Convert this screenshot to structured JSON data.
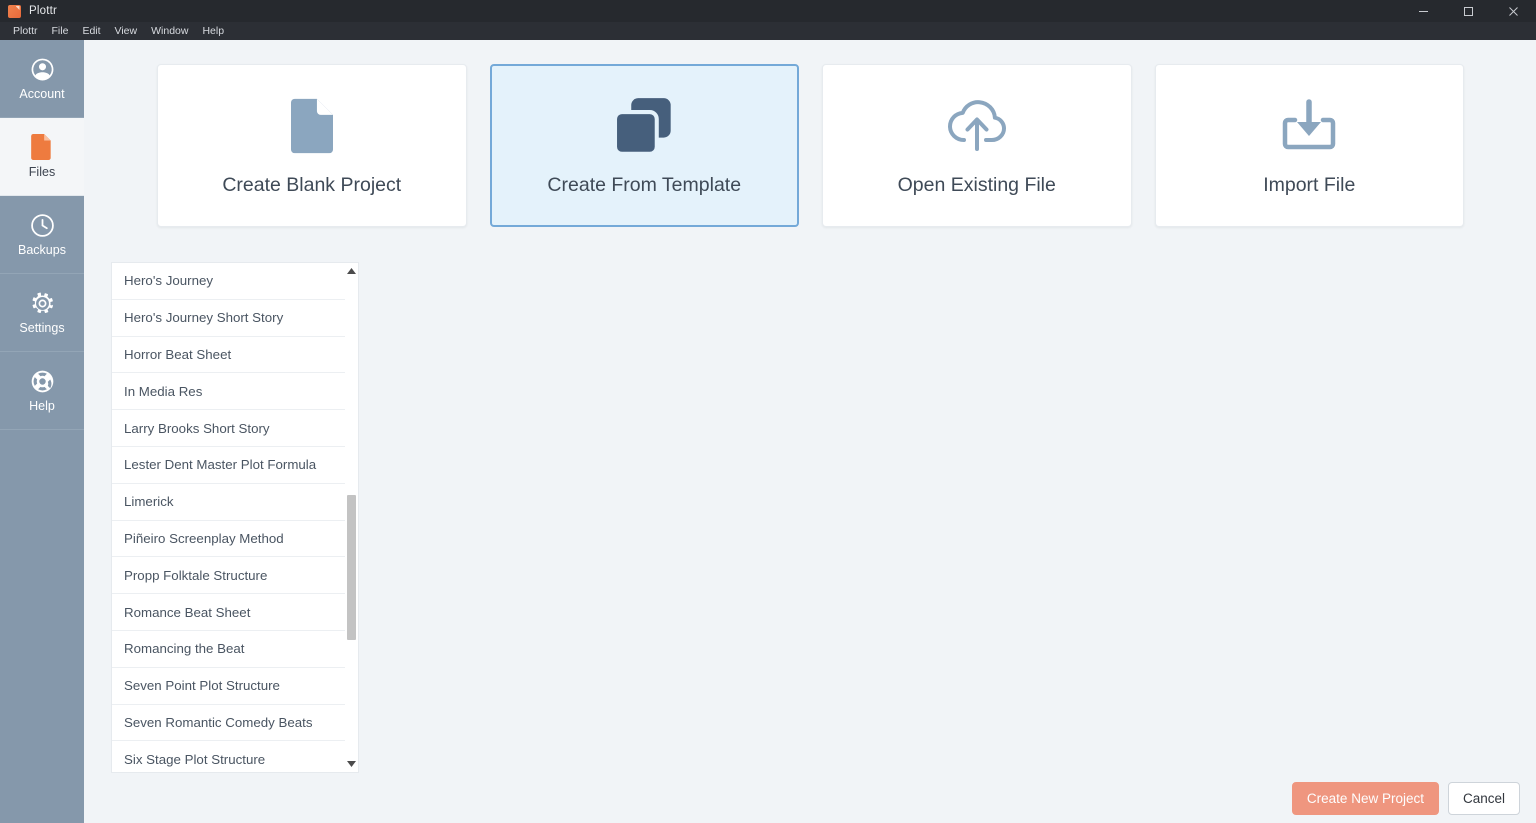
{
  "window": {
    "title": "Plottr",
    "logo_icon": "plottr-logo-icon",
    "controls": {
      "minimize": "minimize-icon",
      "maximize": "maximize-icon",
      "close": "close-icon"
    }
  },
  "menubar": {
    "items": [
      {
        "label": "Plottr"
      },
      {
        "label": "File"
      },
      {
        "label": "Edit"
      },
      {
        "label": "View"
      },
      {
        "label": "Window"
      },
      {
        "label": "Help"
      }
    ]
  },
  "sidebar": {
    "items": [
      {
        "label": "Account",
        "icon": "user-circle-icon",
        "active": false
      },
      {
        "label": "Files",
        "icon": "file-document-icon",
        "active": true
      },
      {
        "label": "Backups",
        "icon": "clock-icon",
        "active": false
      },
      {
        "label": "Settings",
        "icon": "gear-icon",
        "active": false
      },
      {
        "label": "Help",
        "icon": "life-ring-icon",
        "active": false
      }
    ]
  },
  "main": {
    "cards": [
      {
        "label": "Create Blank Project",
        "icon": "blank-document-icon",
        "selected": false
      },
      {
        "label": "Create From Template",
        "icon": "copy-layers-icon",
        "selected": true
      },
      {
        "label": "Open Existing File",
        "icon": "cloud-upload-icon",
        "selected": false
      },
      {
        "label": "Import File",
        "icon": "import-tray-icon",
        "selected": false
      }
    ],
    "template_list": {
      "items": [
        {
          "label": "Hero's Journey"
        },
        {
          "label": "Hero's Journey Short Story"
        },
        {
          "label": "Horror Beat Sheet"
        },
        {
          "label": "In Media Res"
        },
        {
          "label": "Larry Brooks Short Story"
        },
        {
          "label": "Lester Dent Master Plot Formula"
        },
        {
          "label": "Limerick"
        },
        {
          "label": "Piñeiro Screenplay Method"
        },
        {
          "label": "Propp Folktale Structure"
        },
        {
          "label": "Romance Beat Sheet"
        },
        {
          "label": "Romancing the Beat"
        },
        {
          "label": "Seven Point Plot Structure"
        },
        {
          "label": "Seven Romantic Comedy Beats"
        },
        {
          "label": "Six Stage Plot Structure"
        }
      ],
      "scrollbar": {
        "up_arrow_icon": "caret-up-icon",
        "down_arrow_icon": "caret-down-icon"
      }
    }
  },
  "footer": {
    "create_label": "Create New Project",
    "cancel_label": "Cancel"
  },
  "colors": {
    "sidebar_bg": "#8598ab",
    "main_bg": "#f1f4f7",
    "titlebar_bg": "#26292e",
    "accent_orange": "#ef9279",
    "brand_orange": "#ee7b3f",
    "selected_card_bg": "#e4f2fb",
    "selected_card_border": "#74a9d8",
    "card_icon_blue": "#8ba6bf",
    "template_icon_dark": "#465f7c"
  }
}
